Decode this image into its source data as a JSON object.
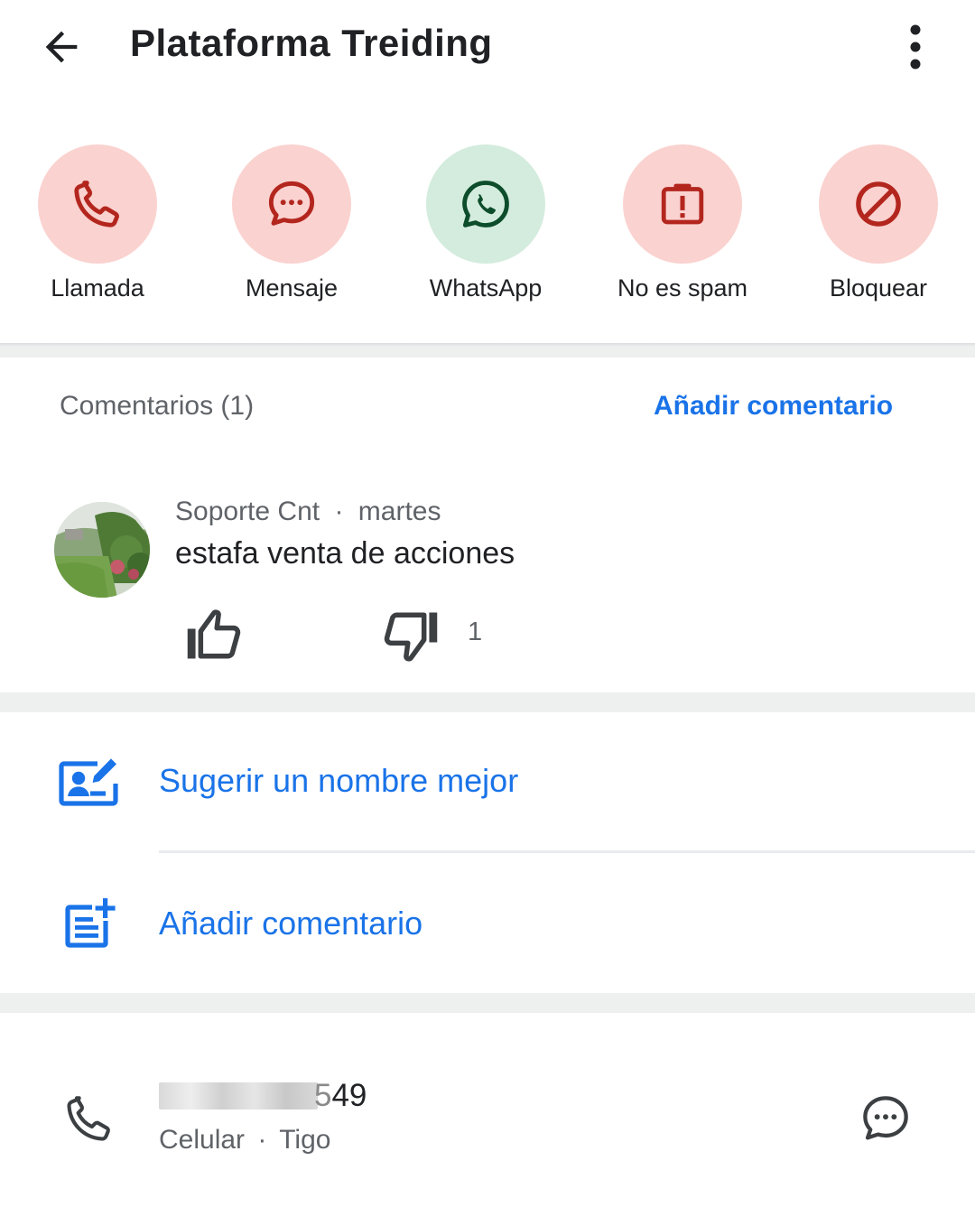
{
  "header": {
    "title": "Plataforma Treiding",
    "back_icon": "arrow-back-icon",
    "more_icon": "more-vertical-icon"
  },
  "actions": [
    {
      "label": "Llamada",
      "icon": "phone-icon",
      "color": "#b3261e",
      "bg": "#fad2cf"
    },
    {
      "label": "Mensaje",
      "icon": "chat-bubble-icon",
      "color": "#b3261e",
      "bg": "#fad2cf"
    },
    {
      "label": "WhatsApp",
      "icon": "whatsapp-icon",
      "color": "#0d4d2c",
      "bg": "#d4ecdd"
    },
    {
      "label": "No es spam",
      "icon": "report-icon",
      "color": "#b3261e",
      "bg": "#fad2cf"
    },
    {
      "label": "Bloquear",
      "icon": "block-icon",
      "color": "#b3261e",
      "bg": "#fad2cf"
    }
  ],
  "comments": {
    "title": "Comentarios (1)",
    "add_label": "Añadir comentario",
    "items": [
      {
        "author": "Soporte Cnt",
        "separator": "·",
        "date": "martes",
        "text": "estafa venta de acciones",
        "dislikes": "1"
      }
    ]
  },
  "list_actions": {
    "suggest_label": "Sugerir un nombre mejor",
    "add_comment_label": "Añadir comentario"
  },
  "number": {
    "visible_suffix": "49",
    "partial_digit": "5",
    "type": "Celular",
    "separator": "·",
    "carrier": "Tigo"
  },
  "colors": {
    "accent": "#1a73e8",
    "danger": "#b3261e",
    "whatsapp": "#0d4d2c"
  }
}
